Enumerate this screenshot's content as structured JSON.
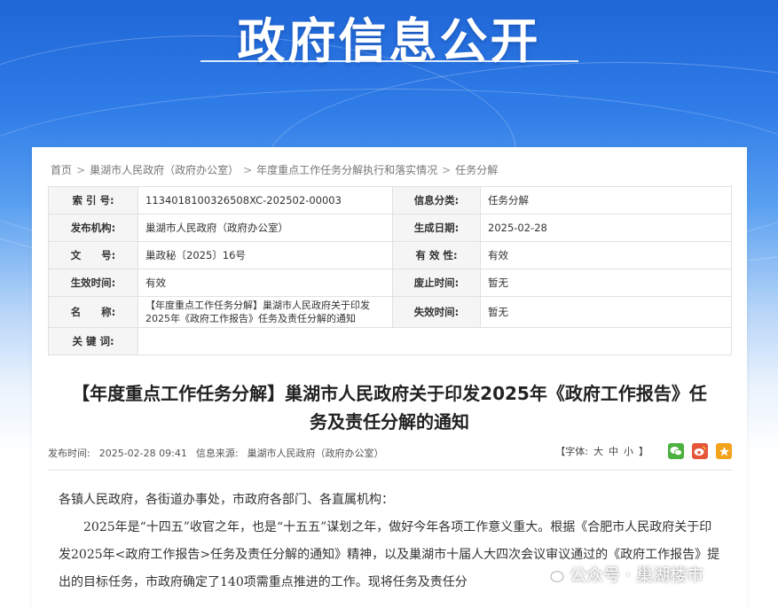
{
  "header": {
    "title": "政府信息公开"
  },
  "breadcrumb": [
    "首页",
    "巢湖市人民政府（政府办公室）",
    "年度重点工作任务分解执行和落实情况",
    "任务分解"
  ],
  "meta": {
    "index_label": "索 引 号:",
    "index_value": "1134018100326508XC-202502-00003",
    "category_label": "信息分类:",
    "category_value": "任务分解",
    "publisher_label": "发布机构:",
    "publisher_value": "巢湖市人民政府（政府办公室）",
    "created_label": "生成日期:",
    "created_value": "2025-02-28",
    "docno_label": "文　　号:",
    "docno_value": "巢政秘〔2025〕16号",
    "validity_label": "有 效 性:",
    "validity_value": "有效",
    "effective_label": "生效时间:",
    "effective_value": "有效",
    "repeal_label": "废止时间:",
    "repeal_value": "暂无",
    "name_label": "名　　称:",
    "name_value": "【年度重点工作任务分解】巢湖市人民政府关于印发2025年《政府工作报告》任务及责任分解的通知",
    "expire_label": "失效时间:",
    "expire_value": "暂无",
    "keyword_label": "关 键 词:",
    "keyword_value": ""
  },
  "article": {
    "title": "【年度重点工作任务分解】巢湖市人民政府关于印发2025年《政府工作报告》任务及责任分解的通知",
    "publish_time_label": "发布时间:",
    "publish_time": "2025-02-28 09:41",
    "source_label": "信息来源:",
    "source": "巢湖市人民政府（政府办公室）",
    "font_label": "【字体:",
    "font_large": "大",
    "font_medium": "中",
    "font_small": "小",
    "font_close": "】",
    "para1": "各镇人民政府，各街道办事处，市政府各部门、各直属机构：",
    "para2": "2025年是“十四五”收官之年，也是“十五五”谋划之年，做好今年各项工作意义重大。根据《合肥市人民政府关于印发2025年<政府工作报告>任务及责任分解的通知》精神，以及巢湖市十届人大四次会议审议通过的《政府工作报告》提出的目标任务，市政府确定了140项需重点推进的工作。现将任务及责任分"
  },
  "watermark": {
    "text": "公众号 · 巢湖楼市"
  },
  "colors": {
    "wechat": "#4bb13f",
    "weibo": "#e6543a",
    "favorite": "#f3a31b"
  }
}
